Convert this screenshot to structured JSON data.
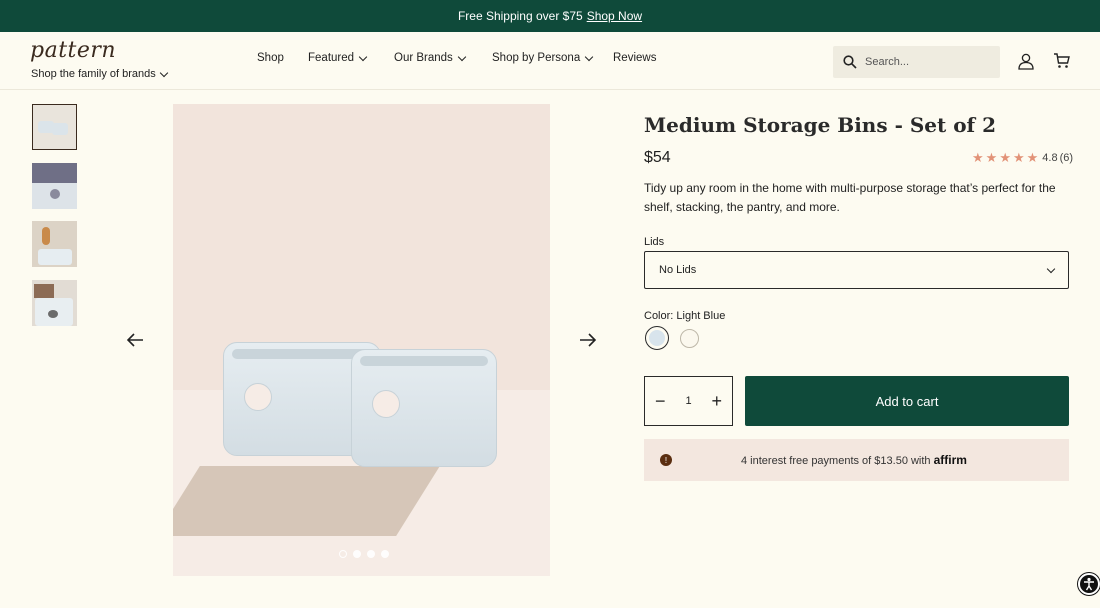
{
  "promo": {
    "text": "Free Shipping over $75",
    "link": "Shop Now"
  },
  "header": {
    "logo": "pattern",
    "family": "Shop the family of brands",
    "nav": [
      {
        "label": "Shop",
        "dropdown": false
      },
      {
        "label": "Featured",
        "dropdown": true
      },
      {
        "label": "Our Brands",
        "dropdown": true
      },
      {
        "label": "Shop by Persona",
        "dropdown": true
      },
      {
        "label": "Reviews",
        "dropdown": false
      }
    ],
    "search_placeholder": "Search..."
  },
  "gallery": {
    "thumbnails": [
      "bins-pair",
      "bins-with-towels",
      "bins-on-shelf",
      "bins-stacked"
    ],
    "active_thumbnail": 0,
    "slide_count": 4,
    "active_slide": 0
  },
  "product": {
    "title": "Medium Storage Bins - Set of 2",
    "price": "$54",
    "rating": "4.8",
    "review_count": "(6)",
    "stars": 5,
    "description": "Tidy up any room in the home with multi-purpose storage that’s perfect for the shelf, stacking, the pantry, and more.",
    "lids_label": "Lids",
    "lids_value": "No Lids",
    "color_label": "Color: Light Blue",
    "swatches": [
      {
        "name": "Light Blue",
        "color": "#d8e4ec",
        "selected": true
      },
      {
        "name": "Cream",
        "color": "#fbf8ee",
        "selected": false
      }
    ],
    "quantity": "1",
    "add_to_cart": "Add to cart",
    "affirm_text": "4 interest free payments of $13.50 with",
    "affirm_logo": "affirm"
  },
  "colors": {
    "brand_green": "#0f4a3a",
    "background": "#fdfbf1",
    "star": "#e29277"
  }
}
